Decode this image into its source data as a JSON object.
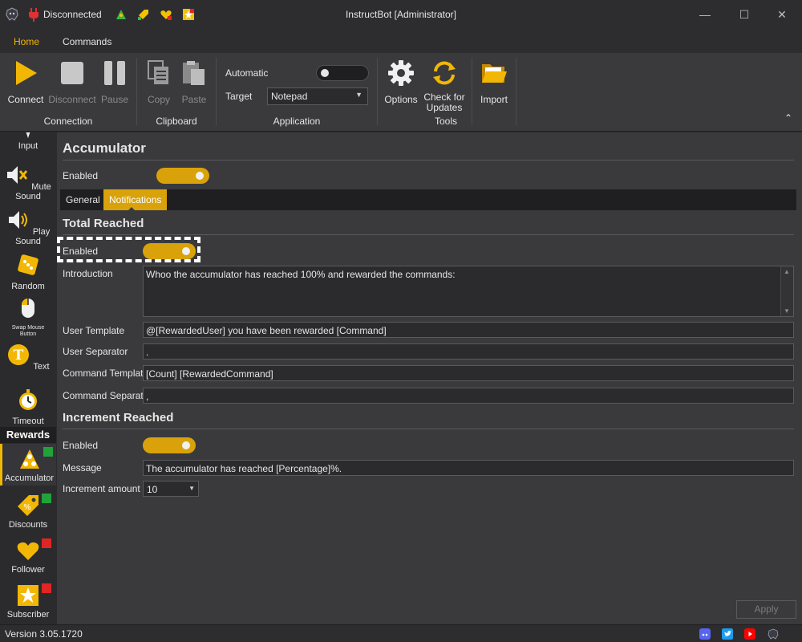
{
  "titlebar": {
    "connection_status": "Disconnected",
    "title": "InstructBot [Administrator]",
    "minimize": "—",
    "maximize": "☐",
    "close": "✕"
  },
  "ribbon_tabs": [
    "Home",
    "Commands"
  ],
  "ribbon": {
    "connect": "Connect",
    "disconnect": "Disconnect",
    "pause": "Pause",
    "copy": "Copy",
    "paste": "Paste",
    "automatic_label": "Automatic",
    "automatic_on": false,
    "target_label": "Target",
    "target_value": "Notepad",
    "options": "Options",
    "check_updates": "Check for Updates",
    "import": "Import",
    "groups": {
      "connection": "Connection",
      "clipboard": "Clipboard",
      "application": "Application",
      "tools": "Tools"
    },
    "collapse": "⌃"
  },
  "sidebar": {
    "items": [
      {
        "label": "Input"
      },
      {
        "label": "Mute Sound"
      },
      {
        "label": "Play Sound"
      },
      {
        "label": "Random"
      },
      {
        "label": "Swap Mouse Button"
      },
      {
        "label": "Text"
      },
      {
        "label": "Timeout"
      }
    ],
    "section": "Rewards",
    "rewards": [
      {
        "label": "Accumulator",
        "status": "green"
      },
      {
        "label": "Discounts",
        "status": "green"
      },
      {
        "label": "Follower",
        "status": "red"
      },
      {
        "label": "Subscriber",
        "status": "red"
      }
    ]
  },
  "main": {
    "title": "Accumulator",
    "enabled_label": "Enabled",
    "enabled": true,
    "tabs": [
      "General",
      "Notifications"
    ],
    "active_tab": "Notifications",
    "total_reached": {
      "heading": "Total Reached",
      "enabled_label": "Enabled",
      "enabled": true,
      "introduction_label": "Introduction",
      "introduction": "Whoo the accumulator has reached 100% and rewarded the commands:",
      "user_template_label": "User Template",
      "user_template": "@[RewardedUser] you have been rewarded [Command]",
      "user_separator_label": "User Separator",
      "user_separator": ".",
      "command_template_label": "Command Template",
      "command_template": "[Count] [RewardedCommand]",
      "command_separator_label": "Command Separator",
      "command_separator": ","
    },
    "increment_reached": {
      "heading": "Increment Reached",
      "enabled_label": "Enabled",
      "enabled": true,
      "message_label": "Message",
      "message": "The accumulator has reached [Percentage]%.",
      "increment_label": "Increment amount",
      "increment_value": "10"
    },
    "apply": "Apply"
  },
  "statusbar": {
    "version": "Version 3.05.1720"
  },
  "colors": {
    "accent": "#d9a20a",
    "status_green": "#22a33a",
    "status_red": "#e02525"
  }
}
